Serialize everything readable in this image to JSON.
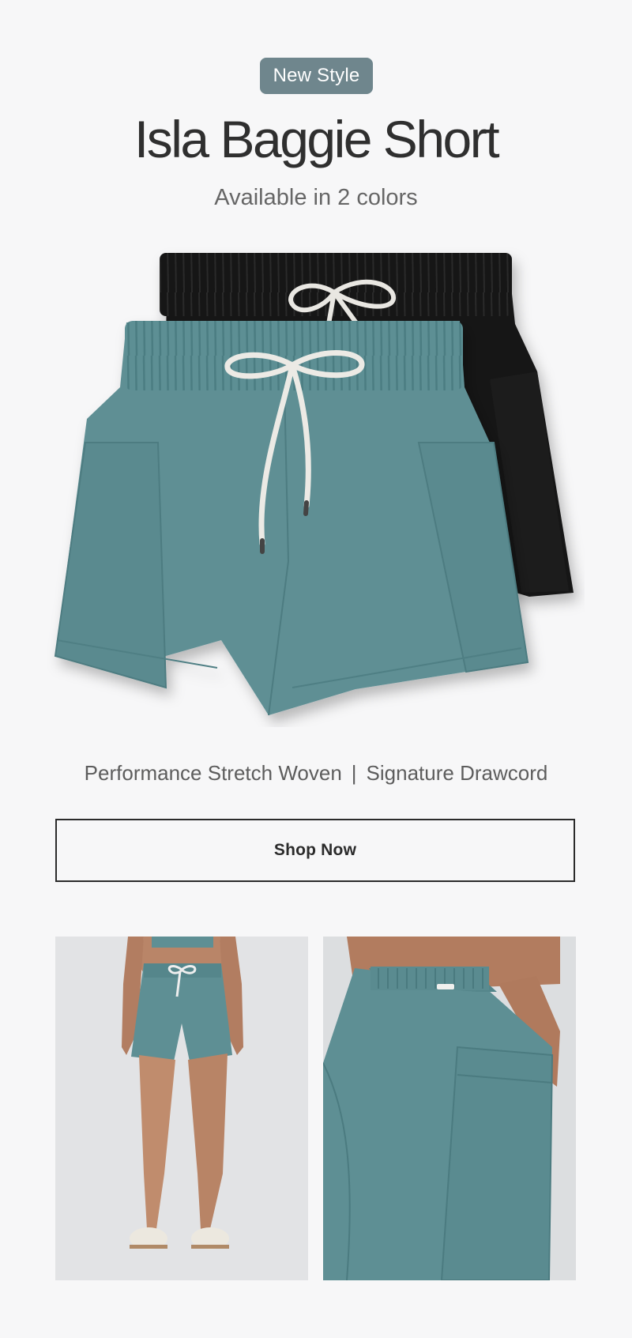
{
  "badge": {
    "label": "New Style"
  },
  "product": {
    "name": "Isla Baggie Short",
    "availability": "Available in 2 colors"
  },
  "features": {
    "left": "Performance Stretch Woven",
    "separator": "|",
    "right": "Signature Drawcord"
  },
  "cta": {
    "label": "Shop Now"
  },
  "colors": {
    "badge_bg": "#6f868d",
    "teal": "#5e8f94",
    "black": "#151515",
    "background": "#f7f7f8"
  },
  "images": {
    "hero": "teal-and-black-shorts-stacked",
    "left": "model-front-view",
    "right": "pocket-detail-view"
  }
}
